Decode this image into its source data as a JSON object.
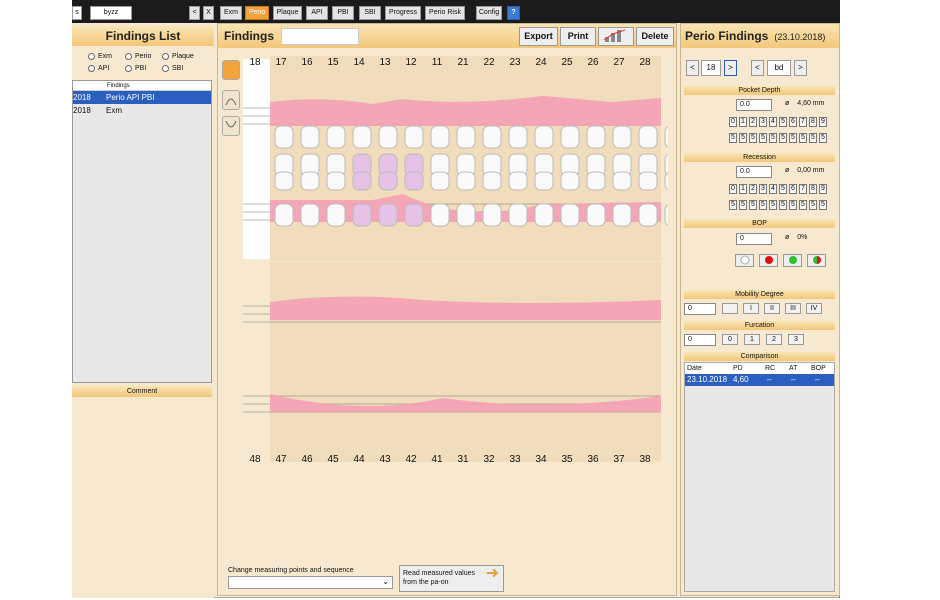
{
  "toolbar": {
    "field1": "s",
    "field2": "byzz",
    "nav_prev": "<",
    "nav_close": "X",
    "buttons": [
      "Exm",
      "Perio",
      "Plaque",
      "API",
      "PBI",
      "SBI",
      "Progress",
      "Perio Risk"
    ],
    "config": "Config",
    "help": "?"
  },
  "findings_list": {
    "title": "Findings List",
    "radios": [
      "Exm",
      "Perio",
      "Plaque",
      "API",
      "PBI",
      "SBI"
    ],
    "header": "Findings",
    "rows": [
      {
        "date": "2018",
        "name": "Perio API PBI",
        "selected": true
      },
      {
        "date": "2018",
        "name": "Exm",
        "selected": false
      }
    ],
    "comment": "Comment"
  },
  "findings": {
    "title": "Findings",
    "export": "Export",
    "print": "Print",
    "delete": "Delete",
    "upper_teeth": [
      "18",
      "17",
      "16",
      "15",
      "14",
      "13",
      "12",
      "11",
      "21",
      "22",
      "23",
      "24",
      "25",
      "26",
      "27",
      "28"
    ],
    "lower_teeth": [
      "48",
      "47",
      "46",
      "45",
      "44",
      "43",
      "42",
      "41",
      "31",
      "32",
      "33",
      "34",
      "35",
      "36",
      "37",
      "38"
    ],
    "change_label": "Change measuring points and sequence",
    "read_label": "Read measured values from the pa-on"
  },
  "perio": {
    "title": "Perio Findings",
    "date": "(23.10.2018)",
    "nav_prev": "<",
    "tooth": "18",
    "nav_next": ">",
    "surface_prev": "<",
    "surface": "bd",
    "surface_next": ">",
    "pocket_depth": {
      "label": "Pocket Depth",
      "value": "0.0",
      "avg": "4,60 mm"
    },
    "digits": [
      "0",
      "1",
      "2",
      "3",
      "4",
      "5",
      "6",
      "7",
      "8",
      "9"
    ],
    "fives": [
      "5",
      "5",
      "5",
      "5",
      "5",
      "5",
      "5",
      "5",
      "5",
      "5"
    ],
    "recession": {
      "label": "Recession",
      "value": "0.0",
      "avg": "0,00 mm"
    },
    "bop": {
      "label": "BOP",
      "value": "0",
      "avg": "0%"
    },
    "mobility": {
      "label": "Mobility Degree",
      "value": "0",
      "options": [
        "",
        "I",
        "II",
        "III",
        "IV"
      ]
    },
    "furcation": {
      "label": "Furcation",
      "value": "0",
      "options": [
        "0",
        "1",
        "2",
        "3"
      ]
    },
    "comparison": {
      "label": "Comparison",
      "headers": [
        "Date",
        "PD",
        "RC",
        "AT",
        "BOP"
      ],
      "row": [
        "23.10.2018",
        "4,60",
        "–",
        "–",
        "–"
      ]
    },
    "avg_symbol": "ø"
  },
  "colors": {
    "accent": "#f2a33c",
    "gum": "#f6a7bd",
    "selection": "#2a5ebf",
    "bop_red": "#e01010",
    "bop_green": "#2fbf2f"
  }
}
